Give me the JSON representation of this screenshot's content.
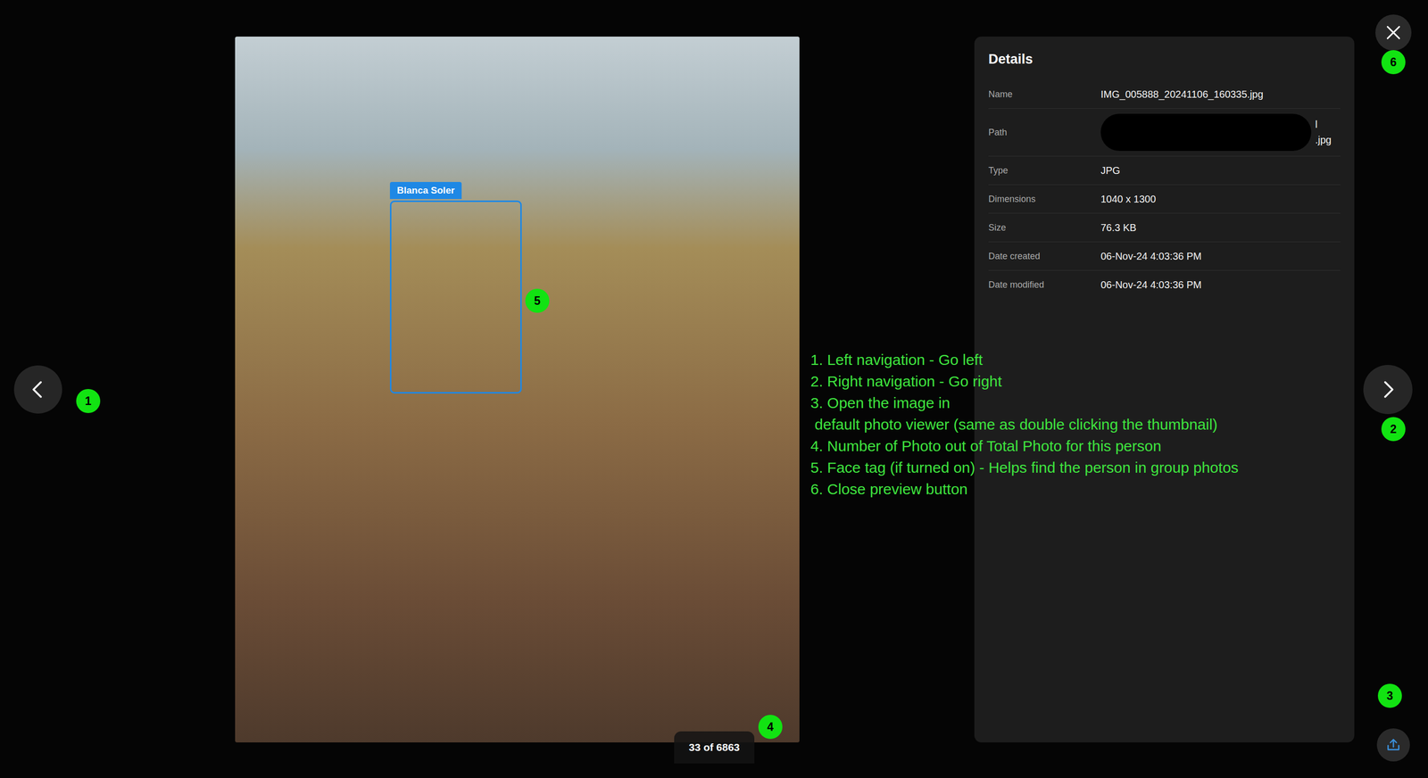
{
  "photo": {
    "face_tag": "Blanca Soler",
    "counter": "33 of 6863"
  },
  "details": {
    "title": "Details",
    "rows": [
      {
        "label": "Name",
        "kind": "text",
        "value": "IMG_005888_20241106_160335.jpg"
      },
      {
        "label": "Path",
        "kind": "redacted",
        "lines": [
          "l",
          ".jpg"
        ]
      },
      {
        "label": "Type",
        "kind": "text",
        "value": "JPG"
      },
      {
        "label": "Dimensions",
        "kind": "text",
        "value": "1040 x 1300"
      },
      {
        "label": "Size",
        "kind": "text",
        "value": "76.3 KB"
      },
      {
        "label": "Date created",
        "kind": "text",
        "value": "06-Nov-24 4:03:36 PM"
      },
      {
        "label": "Date modified",
        "kind": "text",
        "value": "06-Nov-24 4:03:36 PM"
      }
    ]
  },
  "badges": [
    "1",
    "2",
    "3",
    "4",
    "5",
    "6"
  ],
  "annotations": [
    "1. Left navigation - Go left",
    "2. Right navigation - Go right",
    "3. Open the image in",
    " default photo viewer (same as double clicking the thumbnail)",
    "4. Number of Photo out of Total Photo for this person",
    "5. Face tag (if turned on) - Helps find the person in group photos",
    "6. Close preview button"
  ]
}
